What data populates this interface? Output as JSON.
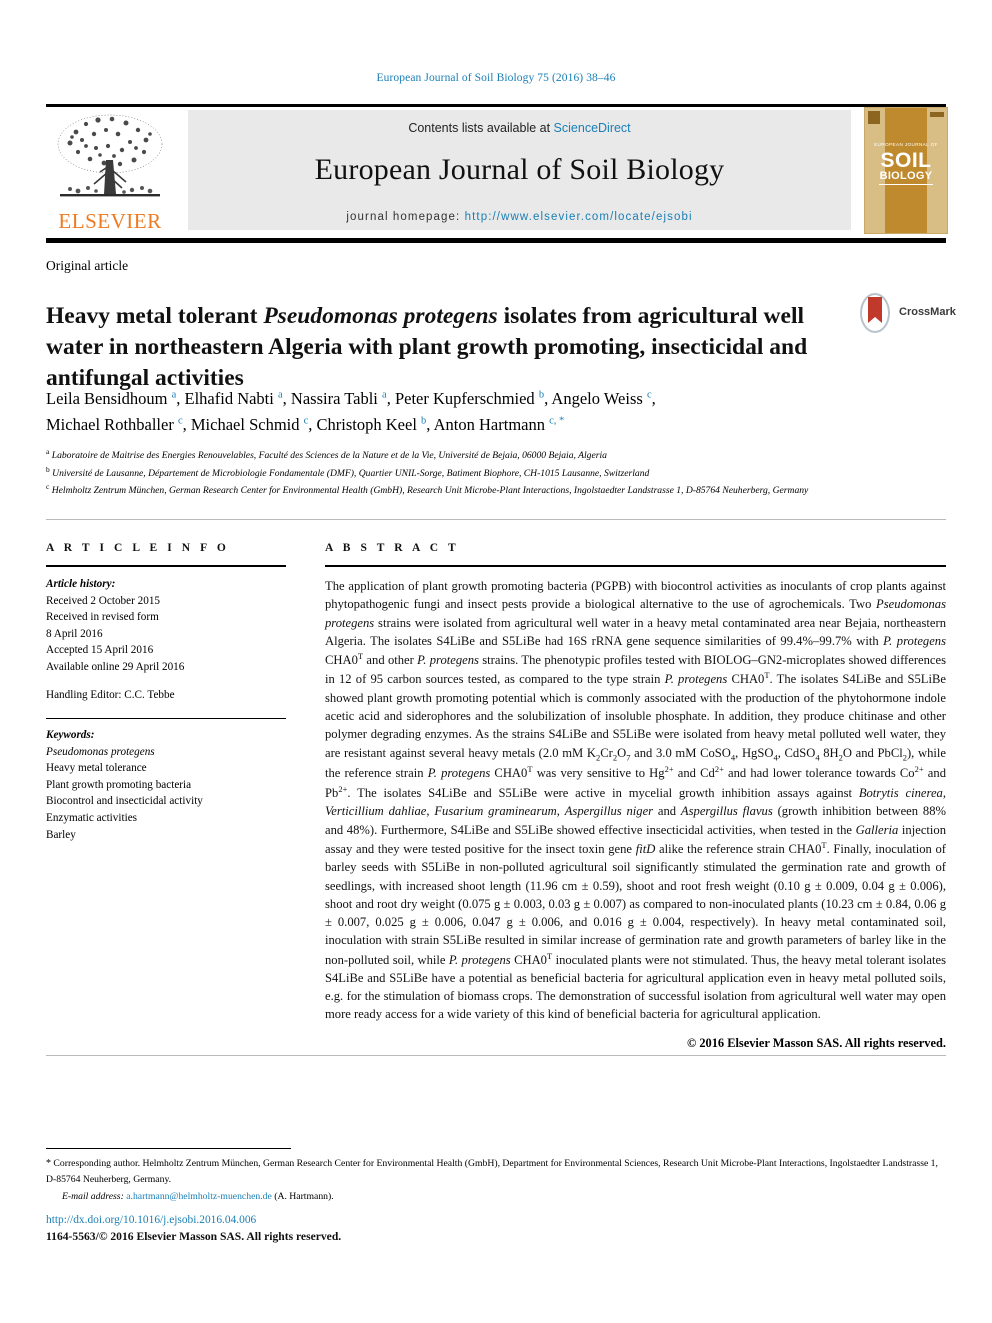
{
  "running_head": "European Journal of Soil Biology 75 (2016) 38–46",
  "masthead": {
    "publisher_name": "ELSEVIER",
    "contents_prefix": "Contents lists available at ",
    "contents_link": "ScienceDirect",
    "journal_name": "European Journal of Soil Biology",
    "homepage_prefix": "journal homepage: ",
    "homepage_url": "http://www.elsevier.com/locate/ejsobi",
    "cover": {
      "line1": "EUROPEAN JOURNAL OF",
      "line2": "SOIL",
      "line3": "BIOLOGY"
    },
    "accent_color": "#1a7fb5",
    "elsevier_orange": "#EE7B22",
    "cover_color": "#bf8a2e"
  },
  "article": {
    "type": "Original article",
    "title_part1": "Heavy metal tolerant ",
    "title_italic": "Pseudomonas protegens",
    "title_part2": " isolates from agricultural well water in northeastern Algeria with plant growth promoting, insecticidal and antifungal activities",
    "crossmark_label": "CrossMark",
    "authors_line1": "Leila Bensidhoum <a>, Elhafid Nabti <a>, Nassira Tabli <a>, Peter Kupferschmied <b>, Angelo Weiss <c>,",
    "authors_line2": "Michael Rothballer <c>, Michael Schmid <c>, Christoph Keel <b>, Anton Hartmann <c,*>",
    "affiliations": [
      {
        "marker": "a",
        "text": "Laboratoire de Maitrise des Energies Renouvelables, Faculté des Sciences de la Nature et de la Vie, Université de Bejaia, 06000 Bejaia, Algeria"
      },
      {
        "marker": "b",
        "text": "Université de Lausanne, Département de Microbiologie Fondamentale (DMF), Quartier UNIL-Sorge, Batiment Biophore, CH-1015 Lausanne, Switzerland"
      },
      {
        "marker": "c",
        "text": "Helmholtz Zentrum München, German Research Center for Environmental Health (GmbH), Research Unit Microbe-Plant Interactions, Ingolstaedter Landstrasse 1, D-85764 Neuherberg, Germany"
      }
    ]
  },
  "article_info": {
    "heading": "A R T I C L E   I N F O",
    "history_label": "Article history:",
    "history": [
      "Received 2 October 2015",
      "Received in revised form",
      "8 April 2016",
      "Accepted 15 April 2016",
      "Available online 29 April 2016"
    ],
    "handling_editor": "Handling Editor: C.C. Tebbe",
    "keywords_label": "Keywords:",
    "keywords": [
      "Pseudomonas protegens",
      "Heavy metal tolerance",
      "Plant growth promoting bacteria",
      "Biocontrol and insecticidal activity",
      "Enzymatic activities",
      "Barley"
    ]
  },
  "abstract": {
    "heading": "A B S T R A C T",
    "copyright": "© 2016 Elsevier Masson SAS. All rights reserved."
  },
  "footer": {
    "corresponding_marker": "*",
    "corresponding_text": "Corresponding author. Helmholtz Zentrum München, German Research Center for Environmental Health (GmbH), Department for Environmental Sciences, Research Unit Microbe-Plant Interactions, Ingolstaedter Landstrasse 1, D-85764 Neuherberg, Germany.",
    "email_label": "E-mail address:",
    "email": "a.hartmann@helmholtz-muenchen.de",
    "email_suffix": "(A. Hartmann).",
    "doi": "http://dx.doi.org/10.1016/j.ejsobi.2016.04.006",
    "issn_line": "1164-5563/© 2016 Elsevier Masson SAS. All rights reserved."
  }
}
